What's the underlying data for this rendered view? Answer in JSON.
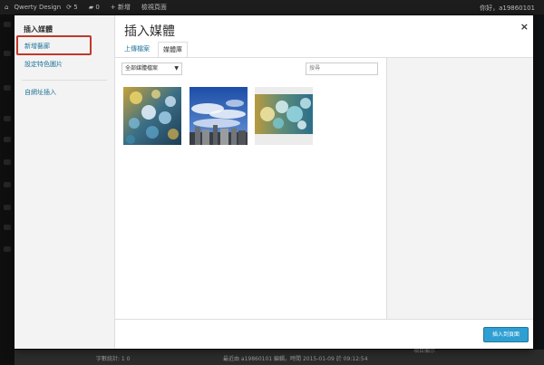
{
  "admin_bar": {
    "site_name": "Qwerty Design",
    "updates_count": "5",
    "comments_count": "0",
    "new_label": "新增",
    "view_page_label": "檢視頁面",
    "greeting": "你好，a19860101"
  },
  "footer": {
    "left_text": "字數統計: 1 0",
    "right_text": "最近由 a19860101 編輯，時間 2015-01-09 於 09:12:54",
    "right_fragment": "項目顯示"
  },
  "modal": {
    "sidebar": {
      "heading": "插入媒體",
      "items": [
        {
          "label": "新增藝廊"
        },
        {
          "label": "設定特色圖片"
        },
        {
          "label": "自網址插入"
        }
      ]
    },
    "title": "插入媒體",
    "close_symbol": "×",
    "tabs": [
      {
        "label": "上傳檔案",
        "active": false
      },
      {
        "label": "媒體庫",
        "active": true
      }
    ],
    "filter": {
      "selected": "全部媒體檔案",
      "arrow": "▼"
    },
    "search": {
      "placeholder": "搜尋"
    },
    "media": [
      {
        "name": "bokeh-yellow-blue"
      },
      {
        "name": "city-sky"
      },
      {
        "name": "bokeh-teal-white"
      }
    ],
    "insert_button": "插入到頁面"
  },
  "colors": {
    "accent": "#2e9fd2",
    "link": "#21759b",
    "highlight_border": "#c0392b"
  }
}
